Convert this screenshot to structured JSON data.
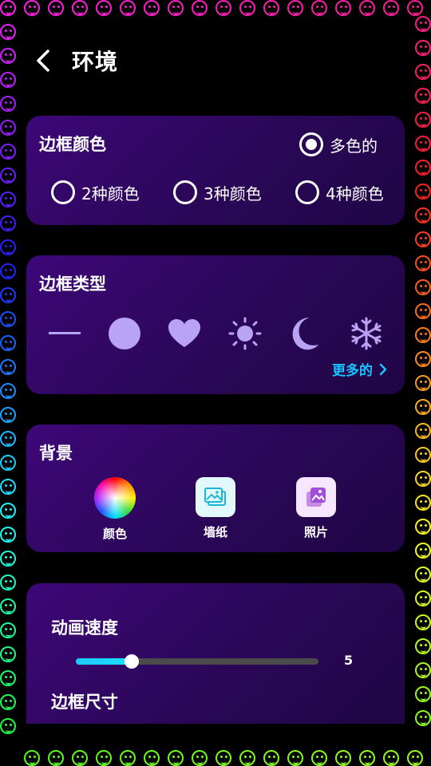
{
  "header": {
    "title": "环境"
  },
  "border_color": {
    "title": "边框颜色",
    "multicolor_label": "多色的",
    "multicolor_selected": true,
    "options": [
      {
        "label": "2种颜色",
        "selected": false
      },
      {
        "label": "3种颜色",
        "selected": false
      },
      {
        "label": "4种颜色",
        "selected": false
      }
    ]
  },
  "border_type": {
    "title": "边框类型",
    "shapes": [
      "line-icon",
      "circle-icon",
      "heart-icon",
      "sun-icon",
      "moon-icon",
      "snowflake-icon"
    ],
    "more_label": "更多的",
    "shape_color": "#b9a3f5"
  },
  "background": {
    "title": "背景",
    "options": [
      {
        "label": "颜色",
        "icon": "color-wheel-icon"
      },
      {
        "label": "墙纸",
        "icon": "wallpaper-icon"
      },
      {
        "label": "照片",
        "icon": "photo-icon"
      }
    ]
  },
  "settings": {
    "speed_title": "动画速度",
    "speed_value": "5",
    "speed_fraction": 0.23,
    "size_title": "边框尺寸"
  },
  "colors": {
    "accent": "#19c3ff",
    "card": "#2f075f",
    "background": "#000000"
  }
}
